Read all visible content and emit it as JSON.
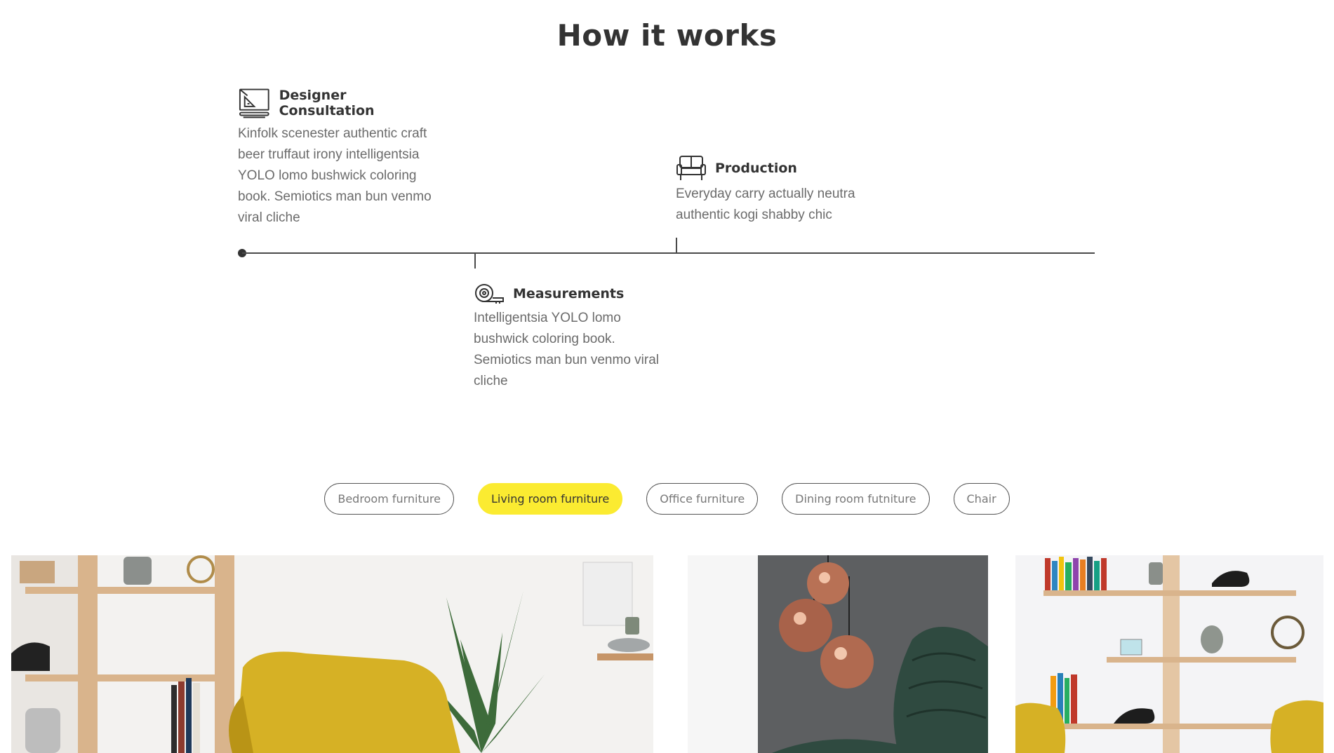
{
  "section_title": "How it works",
  "steps": [
    {
      "title": "Designer Consultation",
      "icon": "drafting-board-icon",
      "text": "Kinfolk scenester authentic craft beer truffaut irony intelligentsia YOLO lomo bushwick coloring book. Semiotics man bun venmo viral cliche"
    },
    {
      "title": "Measurements",
      "icon": "tape-measure-icon",
      "text": "Intelligentsia YOLO lomo bushwick coloring book. Semiotics man bun venmo viral cliche"
    },
    {
      "title": "Production",
      "icon": "sofa-icon",
      "text": "Everyday carry actually neutra authentic kogi shabby chic"
    }
  ],
  "tabs": [
    {
      "label": "Bedroom furniture",
      "active": false
    },
    {
      "label": "Living room furniture",
      "active": true
    },
    {
      "label": "Office furniture",
      "active": false
    },
    {
      "label": "Dining room futniture",
      "active": false
    },
    {
      "label": "Chair",
      "active": false
    }
  ],
  "colors": {
    "accent": "#fbeb31",
    "heading": "#333333",
    "body_text": "#6b6b6b",
    "timeline": "#4a4a4a"
  }
}
